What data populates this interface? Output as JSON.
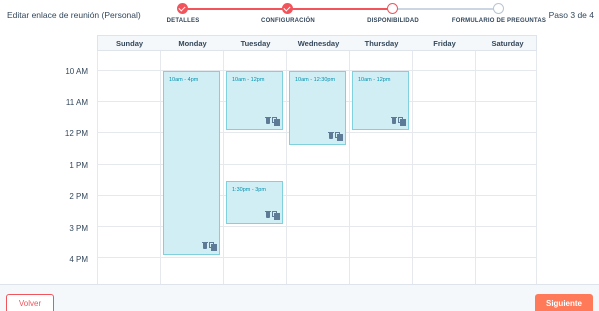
{
  "header": {
    "title": "Editar enlace de reunión (Personal)",
    "step_count": "Paso 3 de 4"
  },
  "steps": [
    {
      "label": "DETALLES",
      "state": "done"
    },
    {
      "label": "CONFIGURACIÓN",
      "state": "done"
    },
    {
      "label": "DISPONIBILIDAD",
      "state": "current"
    },
    {
      "label": "FORMULARIO DE PREGUNTAS",
      "state": "todo"
    }
  ],
  "calendar": {
    "days": [
      "Sunday",
      "Monday",
      "Tuesday",
      "Wednesday",
      "Thursday",
      "Friday",
      "Saturday"
    ],
    "hours": [
      "10 AM",
      "11 AM",
      "12 PM",
      "1 PM",
      "2 PM",
      "3 PM",
      "4 PM"
    ],
    "blocks": [
      {
        "day": "Monday",
        "label": "10am - 4pm"
      },
      {
        "day": "Tuesday",
        "label": "10am - 12pm"
      },
      {
        "day": "Wednesday",
        "label": "10am - 12:30pm"
      },
      {
        "day": "Thursday",
        "label": "10am - 12pm"
      },
      {
        "day": "Tuesday",
        "label": "1:30pm - 3pm"
      }
    ]
  },
  "footer": {
    "back_label": "Volver",
    "next_label": "Siguiente"
  },
  "colors": {
    "accent": "#f2545b",
    "primary_button": "#ff7a59",
    "block_fill": "#d2eef5",
    "block_border": "#7fd1de",
    "block_text": "#0091ae"
  },
  "icons": [
    "check-icon",
    "trash-icon",
    "copy-icon"
  ]
}
